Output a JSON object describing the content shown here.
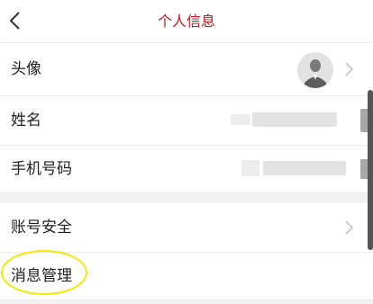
{
  "header": {
    "title": "个人信息",
    "back_icon": "chevron-left-icon",
    "title_color": "#c8161d"
  },
  "rows": {
    "avatar": {
      "label": "头像",
      "icon": "default-avatar-icon",
      "chevron": "chevron-right-icon"
    },
    "name": {
      "label": "姓名"
    },
    "phone": {
      "label": "手机号码"
    },
    "account_security": {
      "label": "账号安全",
      "chevron": "chevron-right-icon"
    },
    "message_management": {
      "label": "消息管理"
    }
  },
  "colors": {
    "highlight": "#f2e800",
    "background": "#f2f2f2",
    "row": "#ffffff"
  }
}
